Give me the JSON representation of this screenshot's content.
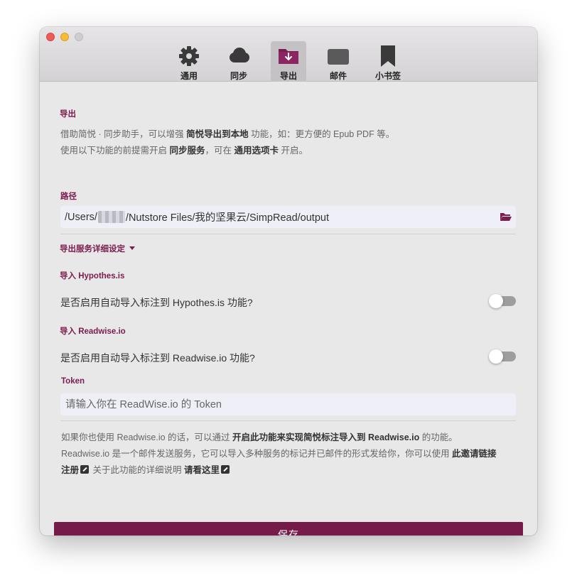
{
  "tabs": [
    {
      "id": "general",
      "label": "通用",
      "icon": "gear-icon"
    },
    {
      "id": "sync",
      "label": "同步",
      "icon": "cloud-icon"
    },
    {
      "id": "export",
      "label": "导出",
      "icon": "folder-download-icon",
      "active": true
    },
    {
      "id": "mail",
      "label": "邮件",
      "icon": "mail-icon"
    },
    {
      "id": "bookmark",
      "label": "小书签",
      "icon": "bookmark-icon"
    }
  ],
  "export": {
    "title": "导出",
    "desc1": {
      "a": "借助简悦 · 同步助手，可以增强 ",
      "b": "简悦导出到本地",
      "c": " 功能，如：更方便的 Epub PDF 等。"
    },
    "desc2": {
      "a": "使用以下功能的前提需开启 ",
      "b": "同步服务",
      "c": "，可在 ",
      "d": "通用选项卡",
      "e": " 开启。"
    },
    "path_label": "路径",
    "path_prefix": "/Users/",
    "path_suffix": "/Nutstore Files/我的坚果云/SimpRead/output",
    "detail_toggle": "导出服务详细设定"
  },
  "hypothesis": {
    "title": "导入 Hypothes.is",
    "question": "是否启用自动导入标注到 Hypothes.is 功能?",
    "enabled": false
  },
  "readwise": {
    "title": "导入 Readwise.io",
    "question": "是否启用自动导入标注到 Readwise.io 功能?",
    "enabled": false,
    "token_label": "Token",
    "token_placeholder": "请输入你在 ReadWise.io 的 Token",
    "info1": {
      "a": "如果你也使用 Readwise.io 的话，可以通过 ",
      "b": "开启此功能来实现简悦标注导入到 Readwise.io",
      "c": " 的功能。"
    },
    "info2": {
      "a": "Readwise.io 是一个邮件发送服务，它可以导入多种服务的标记并已邮件的形式发给你，你可以使用 ",
      "b": "此邀请链接"
    },
    "info3": {
      "a": "注册",
      "b": " 关于此功能的详细说明 ",
      "c": "请看这里"
    }
  },
  "save_label": "保存",
  "colors": {
    "accent": "#761a4a",
    "title": "#7b1b4e"
  }
}
